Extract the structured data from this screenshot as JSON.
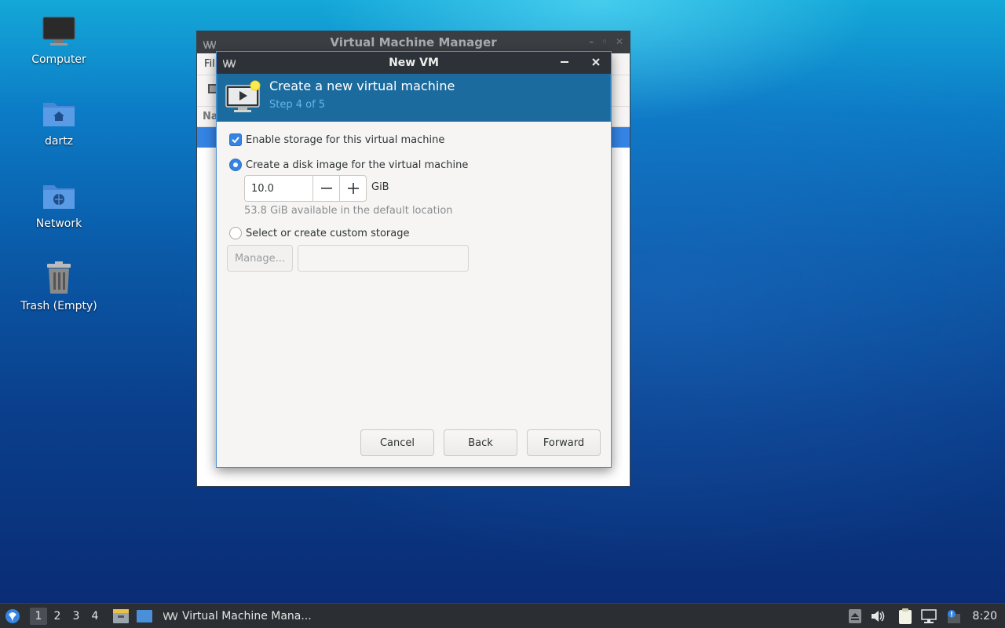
{
  "desktop": {
    "icons": [
      {
        "label": "Computer"
      },
      {
        "label": "dartz"
      },
      {
        "label": "Network"
      },
      {
        "label": "Trash (Empty)"
      }
    ]
  },
  "vmm": {
    "title": "Virtual Machine Manager",
    "menu_partial": "Fil",
    "column_partial": "Na"
  },
  "dialog": {
    "title": "New VM",
    "banner_title": "Create a new virtual machine",
    "banner_subtitle": "Step 4 of 5",
    "enable_storage_label": "Enable storage for this virtual machine",
    "create_disk_label": "Create a disk image for the virtual machine",
    "disk_size_value": "10.0",
    "disk_unit": "GiB",
    "available_hint": "53.8 GiB available in the default location",
    "custom_storage_label": "Select or create custom storage",
    "manage_label": "Manage...",
    "custom_path_value": "",
    "cancel_label": "Cancel",
    "back_label": "Back",
    "forward_label": "Forward"
  },
  "taskbar": {
    "workspaces": [
      "1",
      "2",
      "3",
      "4"
    ],
    "task_label": "Virtual Machine Mana...",
    "clock": "8:20"
  },
  "colors": {
    "accent": "#3584e4",
    "banner": "#1c6b9e",
    "banner_subtitle": "#66b6ea",
    "titlebar": "#2d3238"
  }
}
